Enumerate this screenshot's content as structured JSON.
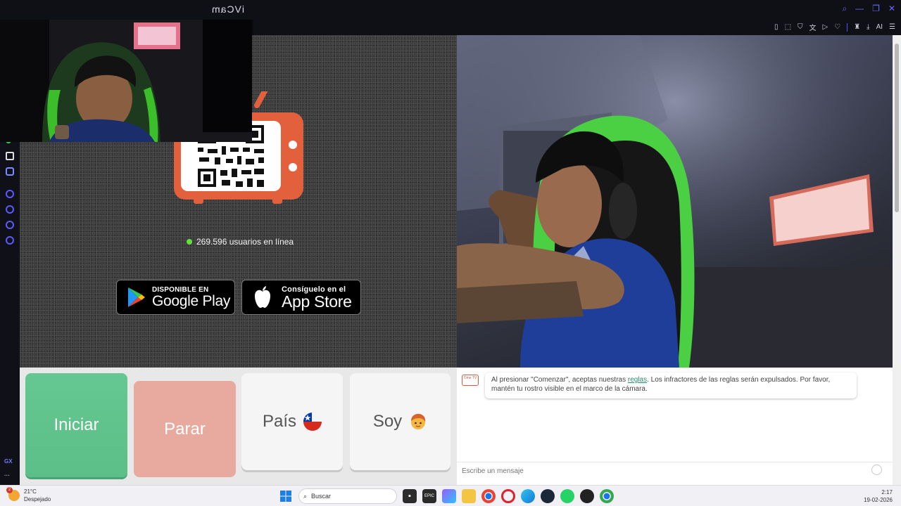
{
  "window": {
    "title": "iVCam"
  },
  "site": {
    "online_count": "269.596 usuarios en línea",
    "google_play": {
      "small": "DISPONIBLE EN",
      "big": "Google Play"
    },
    "app_store": {
      "small": "Consíguelo en el",
      "big": "App Store"
    }
  },
  "controls": {
    "start_label": "Iniciar",
    "stop_label": "Parar",
    "country_label": "País",
    "country_flag": "🇨🇱",
    "gender_label": "Soy",
    "gender_emoji": "👦"
  },
  "chat": {
    "logo_text": "Ome TV",
    "notice_before": "Al presionar \"Comenzar\", aceptas nuestras ",
    "notice_link": "reglas",
    "notice_after": ". Los infractores de las reglas serán expulsados. Por favor, mantén tu rostro visible en el marco de la cámara.",
    "input_placeholder": "Escribe un mensaje"
  },
  "taskbar": {
    "weather_temp": "21°C",
    "weather_desc": "Despejado",
    "weather_badge": "2",
    "search_placeholder": "Buscar",
    "time": "2:17",
    "date": "19-02-2026"
  },
  "browser": {
    "ai_label": "AI",
    "sidebar_label": "GX"
  },
  "colors": {
    "start": "#5bbf87",
    "stop": "#e8aa9e",
    "online_dot": "#5ee23a",
    "brand": "#d25a3c"
  }
}
